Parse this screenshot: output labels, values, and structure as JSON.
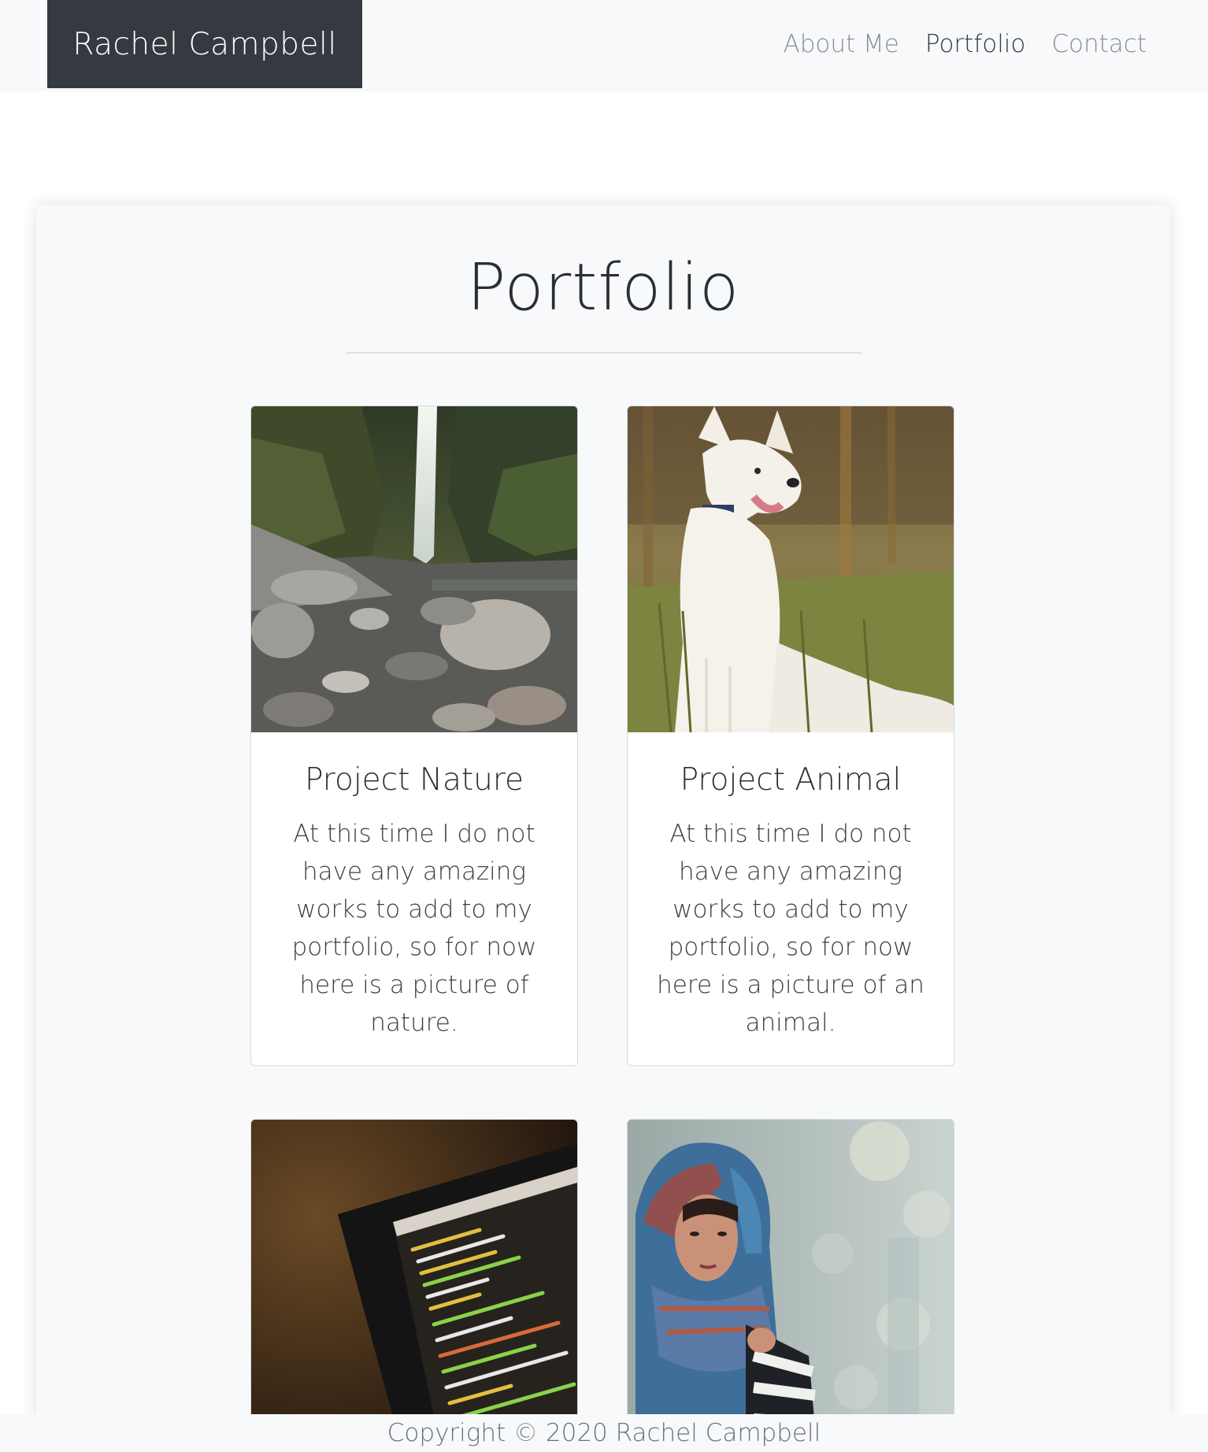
{
  "navbar": {
    "brand": "Rachel Campbell",
    "links": [
      {
        "label": "About Me",
        "active": false
      },
      {
        "label": "Portfolio",
        "active": true
      },
      {
        "label": "Contact",
        "active": false
      }
    ]
  },
  "main": {
    "title": "Portfolio",
    "cards": [
      {
        "image": "waterfall-photo",
        "title": "Project Nature",
        "text": "At this time I do not have any amazing works to add to my portfolio, so for now here is a picture of nature."
      },
      {
        "image": "white-dog-photo",
        "title": "Project Animal",
        "text": "At this time I do not have any amazing works to add to my portfolio, so for now here is a picture of an animal."
      },
      {
        "image": "code-laptop-photo"
      },
      {
        "image": "hooded-woman-photo"
      }
    ]
  },
  "footer": {
    "copyright": "Copyright © 2020 Rachel Campbell"
  }
}
